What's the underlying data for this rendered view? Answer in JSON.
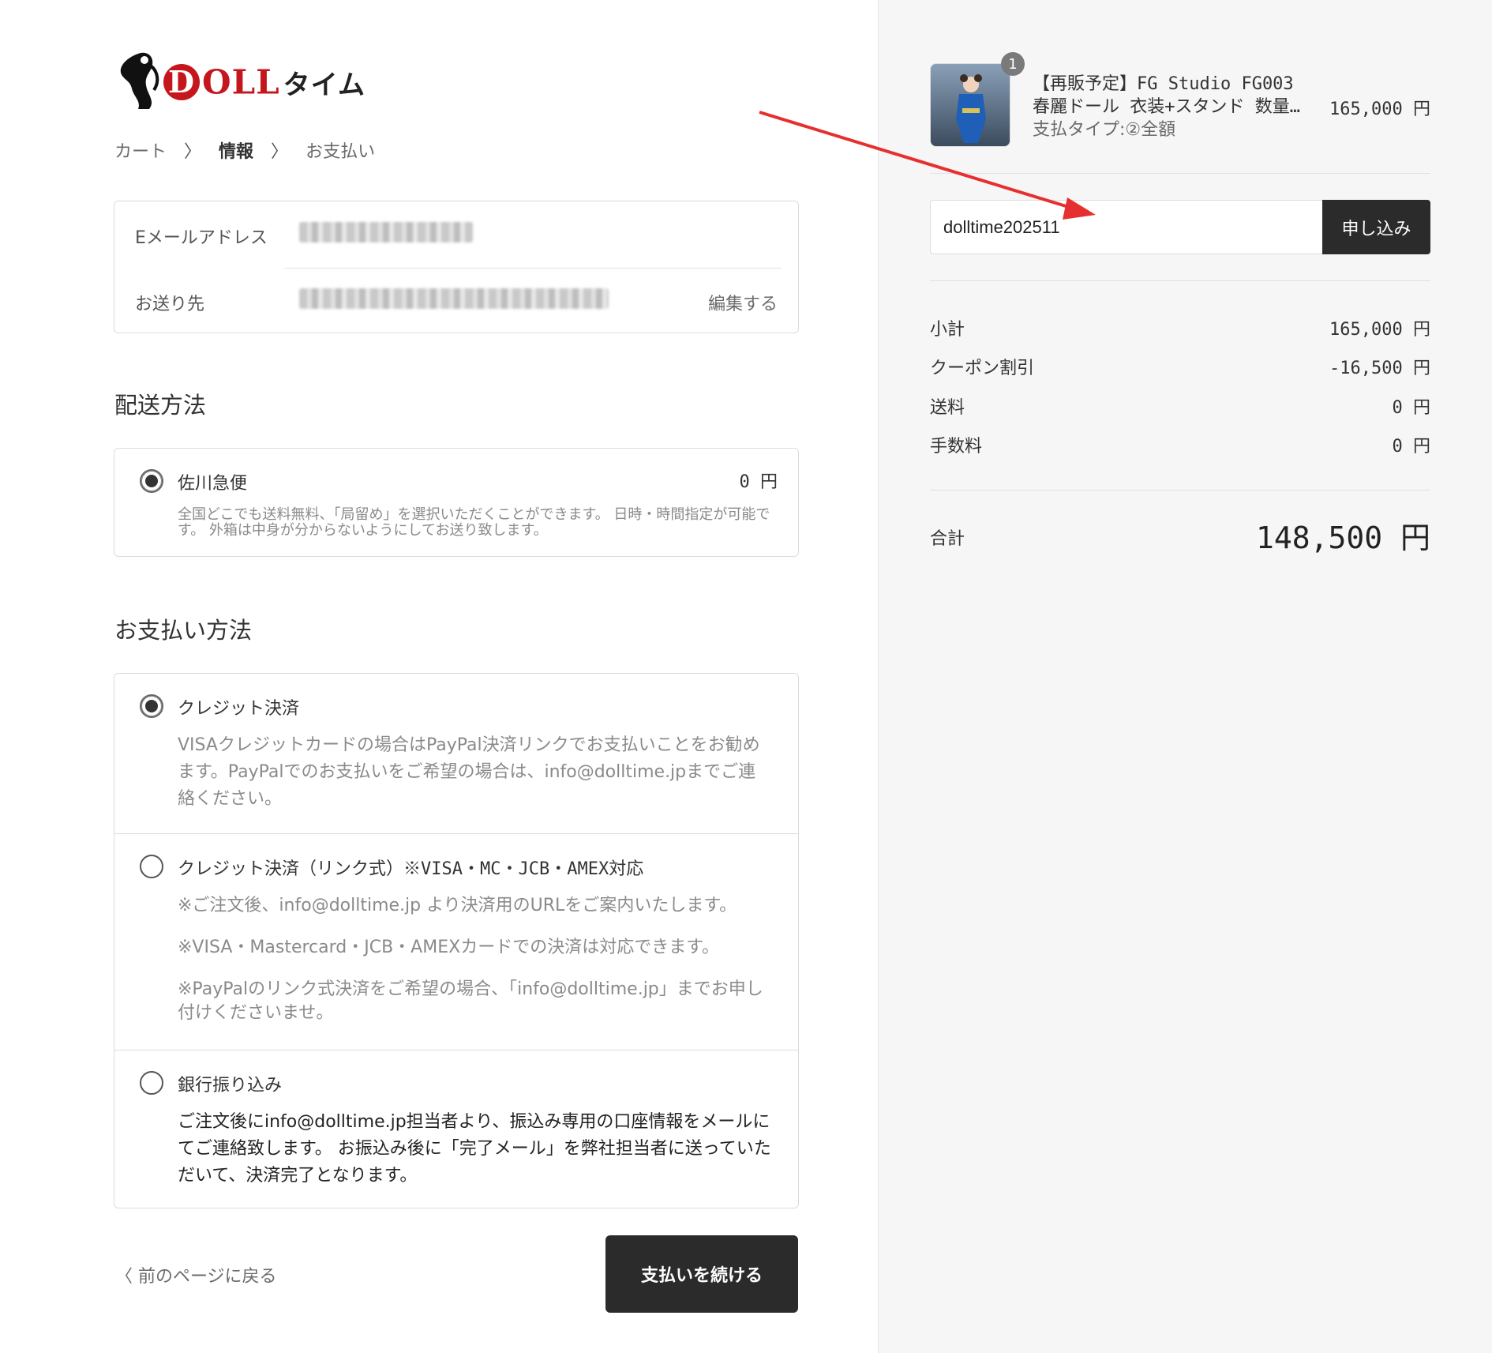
{
  "logo": {
    "letter": "D",
    "rest": "OLL",
    "kana": "タイム"
  },
  "breadcrumb": {
    "cart": "カート",
    "info": "情報",
    "payment": "お支払い",
    "sep": "〉"
  },
  "contact": {
    "email_label": "Eメールアドレス",
    "ship_label": "お送り先",
    "edit": "編集する"
  },
  "shipping": {
    "heading": "配送方法",
    "option": "佐川急便",
    "price": "0 円",
    "desc": "全国どこでも送料無料、「局留め」を選択いただくことができます。 日時・時間指定が可能です。 外箱は中身が分からないようにしてお送り致します。"
  },
  "payment": {
    "heading": "お支払い方法",
    "opt1": {
      "title": "クレジット決済",
      "desc": "VISAクレジットカードの場合はPayPal決済リンクでお支払いことをお勧めます。PayPalでのお支払いをご希望の場合は、info@dolltime.jpまでご連絡ください。"
    },
    "opt2": {
      "title": "クレジット決済（リンク式）※VISA・MC・JCB・AMEX対応",
      "note1": "※ご注文後、info@dolltime.jp より決済用のURLをご案内いたします。",
      "note2": "※VISA・Mastercard・JCB・AMEXカードでの決済は対応できます。",
      "note3": "※PayPalのリンク式決済をご希望の場合、「info@dolltime.jp」までお申し付けくださいませ。"
    },
    "opt3": {
      "title": "銀行振り込み",
      "desc": "ご注文後にinfo@dolltime.jp担当者より、振込み専用の口座情報をメールにてご連絡致します。 お振込み後に「完了メール」を弊社担当者に送っていただいて、決済完了となります。"
    }
  },
  "footer": {
    "back": "〈 前のページに戻る",
    "continue": "支払いを続ける"
  },
  "summary": {
    "product": {
      "qty": "1",
      "title_line1": "【再販予定】FG Studio FG003",
      "title_line2": "春麗ドール 衣装+スタンド 数量限定",
      "variant": "支払タイプ:②全額",
      "price": "165,000 円"
    },
    "coupon": {
      "value": "dolltime202511",
      "apply": "申し込み"
    },
    "rows": [
      {
        "label": "小計",
        "value": "165,000 円"
      },
      {
        "label": "クーポン割引",
        "value": "-16,500 円"
      },
      {
        "label": "送料",
        "value": "0 円"
      },
      {
        "label": "手数料",
        "value": "0 円"
      }
    ],
    "total_label": "合計",
    "total_value": "148,500 円"
  },
  "colors": {
    "accent_dark": "#2b2b2b",
    "annotation_arrow": "#e5302f",
    "brand_red": "#c4161c"
  }
}
